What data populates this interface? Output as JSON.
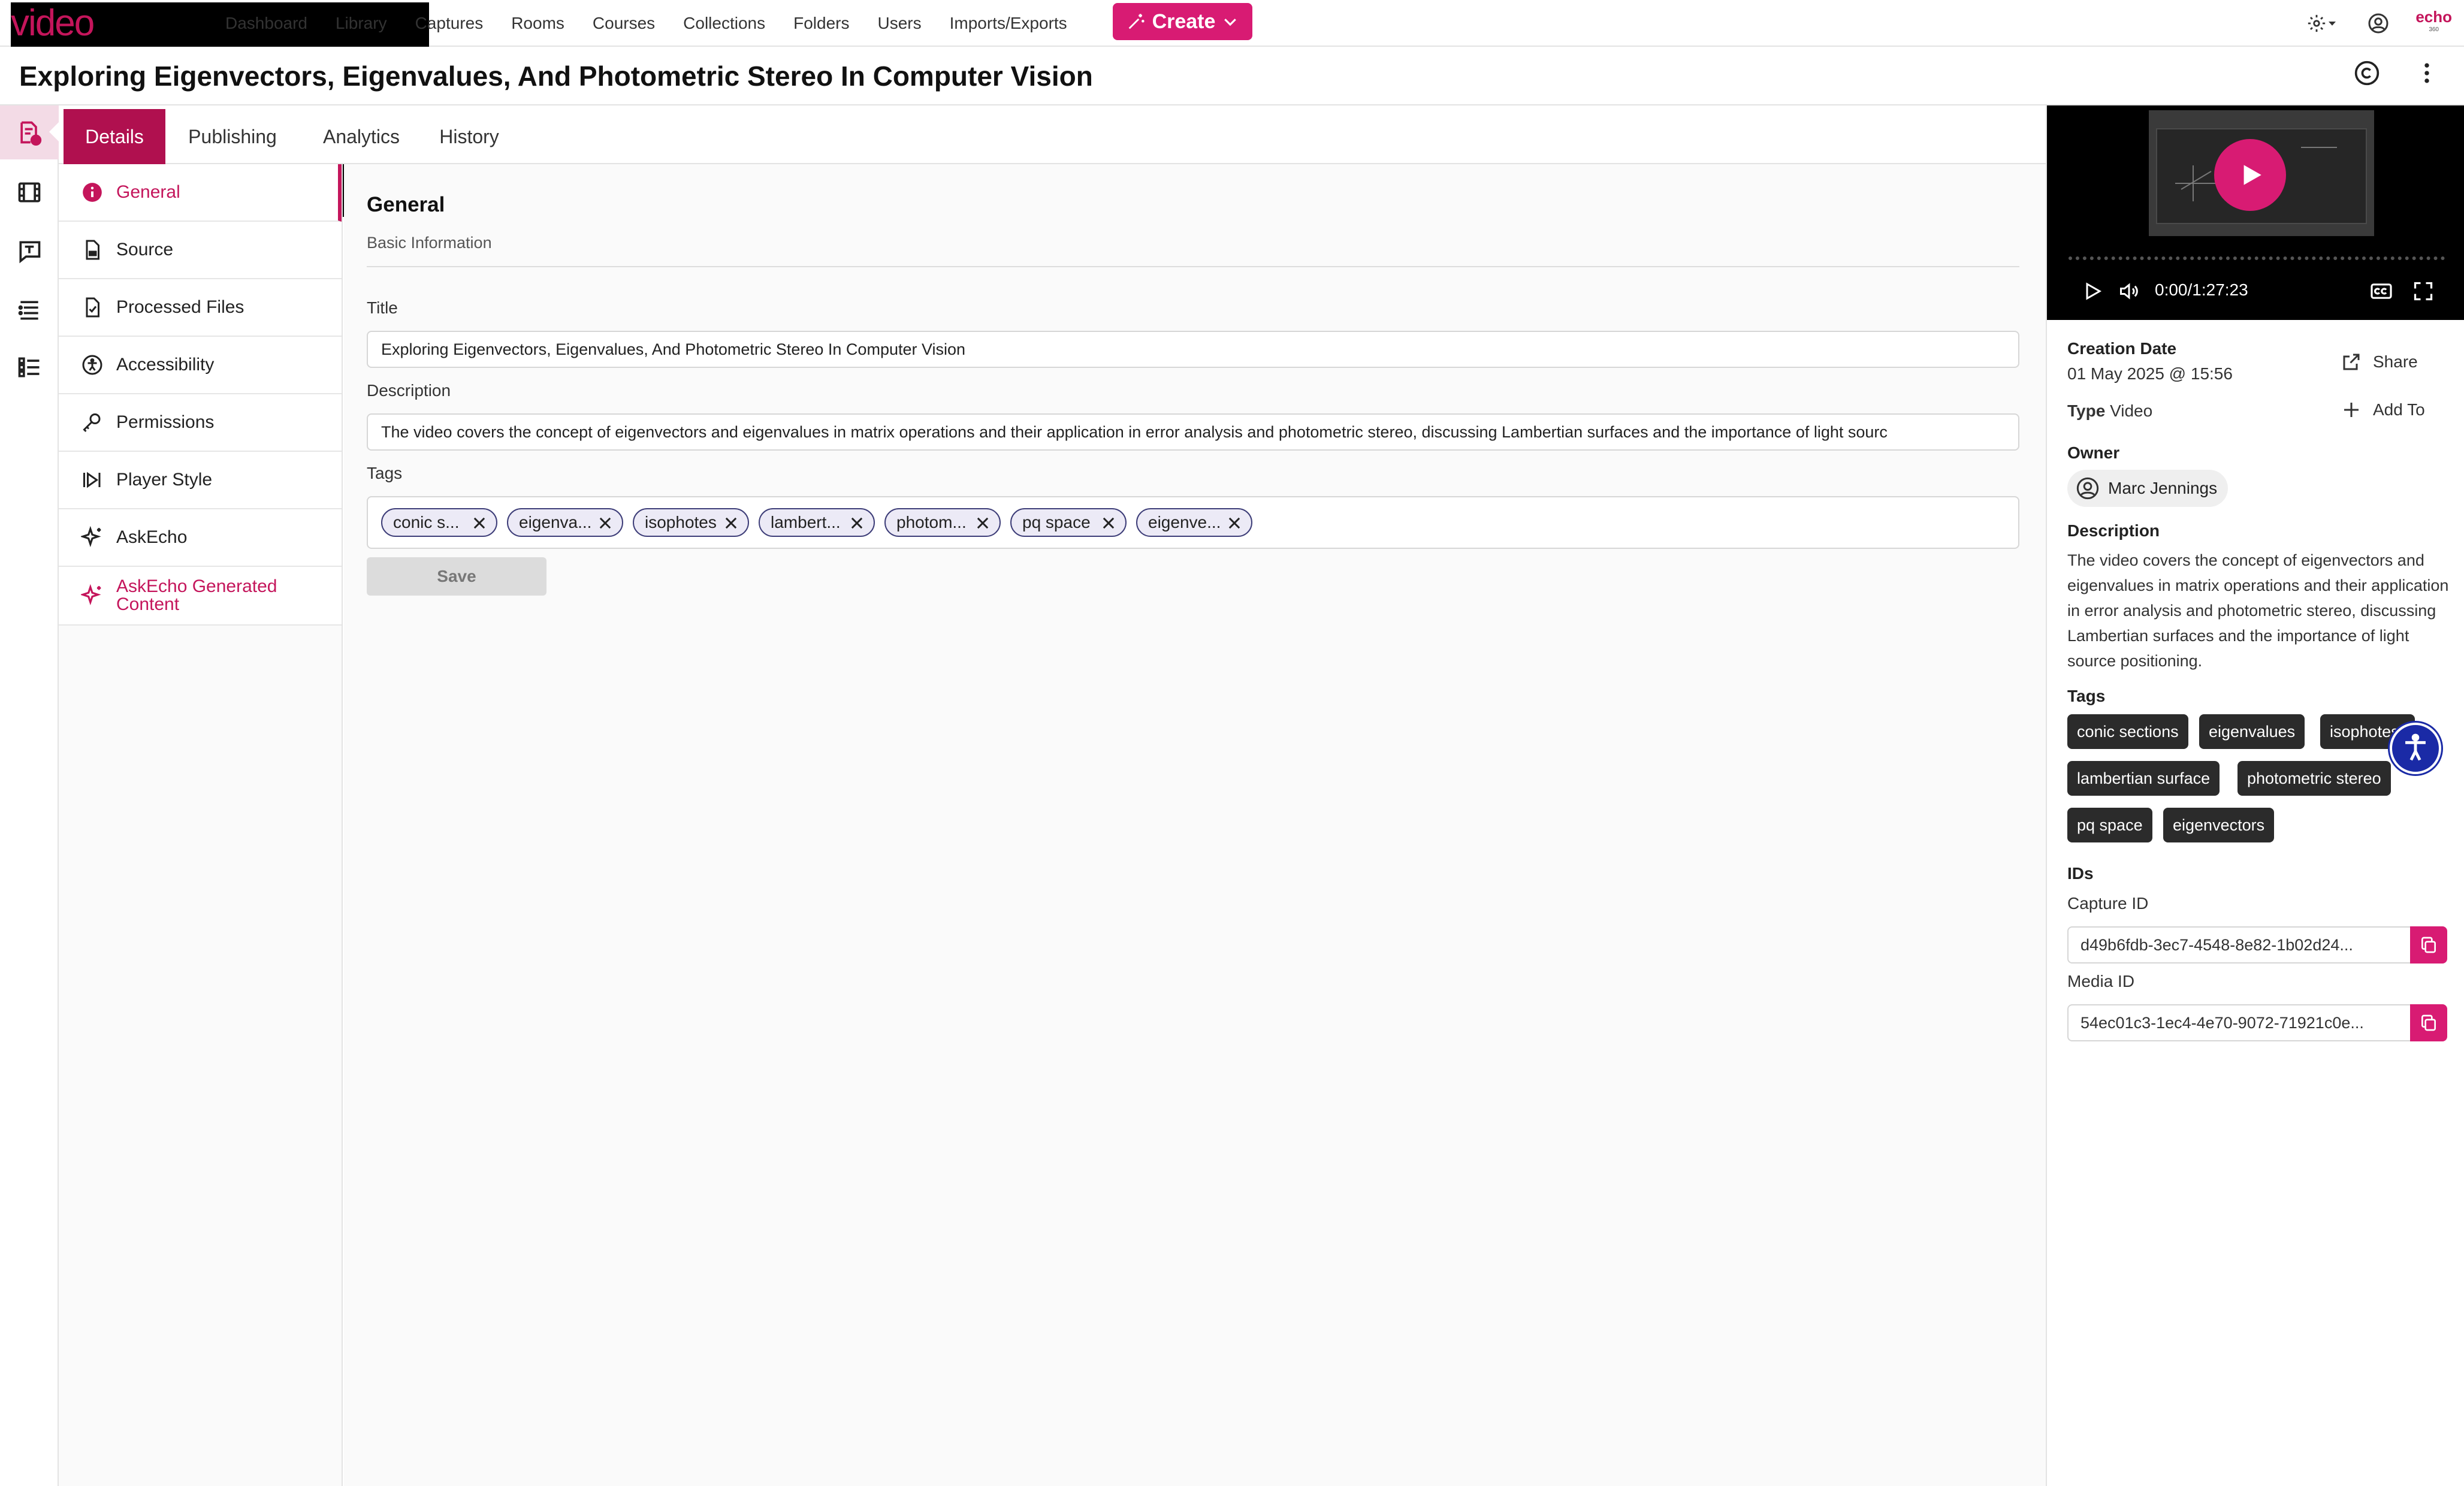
{
  "brand": {
    "logo_echo": "echo",
    "logo_video": "video",
    "accent": "#d81b73",
    "mini_logo": "echo",
    "mini_logo_sub": "360"
  },
  "nav": {
    "links": [
      "Dashboard",
      "Library",
      "Captures",
      "Rooms",
      "Courses",
      "Collections",
      "Folders",
      "Users",
      "Imports/Exports"
    ],
    "create_label": "Create"
  },
  "page": {
    "title": "Exploring Eigenvectors, Eigenvalues, And Photometric Stereo In Computer Vision"
  },
  "tabs": [
    "Details",
    "Publishing",
    "Analytics",
    "History"
  ],
  "sections": [
    "General",
    "Source",
    "Processed Files",
    "Accessibility",
    "Permissions",
    "Player Style",
    "AskEcho",
    "AskEcho Generated Content"
  ],
  "form": {
    "heading": "General",
    "subheading": "Basic Information",
    "title_label": "Title",
    "title_value": "Exploring Eigenvectors, Eigenvalues, And Photometric Stereo In Computer Vision",
    "description_label": "Description",
    "description_value": "The video covers the concept of eigenvectors and eigenvalues in matrix operations and their application in error analysis and photometric stereo, discussing Lambertian surfaces and the importance of light sourc",
    "tags_label": "Tags",
    "tags": [
      "conic s...",
      "eigenva...",
      "isophotes",
      "lambert...",
      "photom...",
      "pq space",
      "eigenve..."
    ],
    "save_label": "Save"
  },
  "player": {
    "time": "0:00/1:27:23"
  },
  "details": {
    "creation_date_label": "Creation Date",
    "creation_date": "01 May 2025 @ 15:56",
    "type_label": "Type",
    "type_value": "Video",
    "share_label": "Share",
    "add_to_label": "Add To",
    "owner_label": "Owner",
    "owner_name": "Marc Jennings",
    "description_label": "Description",
    "description": "The video covers the concept of eigenvectors and eigenvalues in matrix operations and their application in error analysis and photometric stereo, discussing Lambertian surfaces and the importance of light source positioning.",
    "tags_label": "Tags",
    "tags": [
      "conic sections",
      "eigenvalues",
      "isophotes",
      "lambertian surface",
      "photometric stereo",
      "pq space",
      "eigenvectors"
    ],
    "ids_label": "IDs",
    "capture_id_label": "Capture ID",
    "capture_id": "d49b6fdb-3ec7-4548-8e82-1b02d24...",
    "media_id_label": "Media ID",
    "media_id": "54ec01c3-1ec4-4e70-9072-71921c0e..."
  }
}
